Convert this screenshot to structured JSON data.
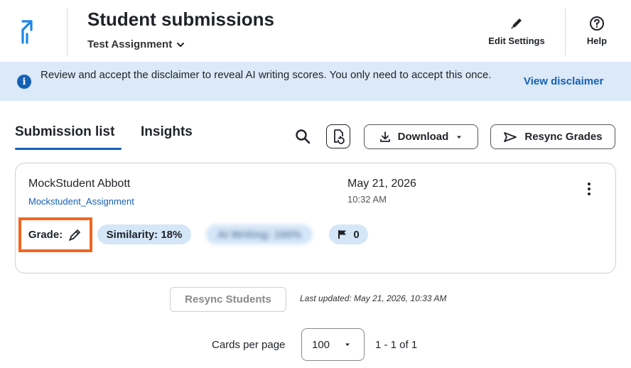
{
  "header": {
    "title": "Student submissions",
    "assignment": "Test Assignment",
    "edit_settings_label": "Edit Settings",
    "help_label": "Help"
  },
  "banner": {
    "message": "Review and accept the disclaimer to reveal AI writing scores. You only need to accept this once.",
    "link": "View disclaimer"
  },
  "tabs": [
    {
      "label": "Submission list",
      "active": true
    },
    {
      "label": "Insights",
      "active": false
    }
  ],
  "toolbar": {
    "download_label": "Download",
    "resync_grades_label": "Resync Grades"
  },
  "submission": {
    "student_name": "MockStudent Abbott",
    "file_name": "Mockstudent_Assignment",
    "date": "May 21, 2026",
    "time": "10:32 AM",
    "grade_label": "Grade:",
    "similarity": "Similarity: 18%",
    "ai_writing": "AI Writing: 100%",
    "flag_count": "0"
  },
  "footer": {
    "resync_students_label": "Resync Students",
    "last_updated": "Last updated: May 21, 2026, 10:33 AM",
    "cards_per_page_label": "Cards per page",
    "cards_per_page_value": "100",
    "range": "1 - 1 of 1"
  },
  "colors": {
    "accent": "#1560b7",
    "banner_bg": "#dbe9f8",
    "pill_bg": "#d4e6f8",
    "highlight": "#f26522"
  },
  "icons": [
    "logo-icon",
    "chevron-down-icon",
    "pencil-icon",
    "help-icon",
    "info-icon",
    "search-icon",
    "export-icon",
    "download-icon",
    "caret-down-icon",
    "send-icon",
    "kebab-menu-icon",
    "flag-icon"
  ]
}
